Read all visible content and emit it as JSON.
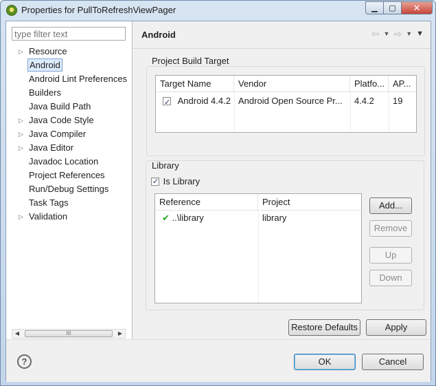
{
  "window": {
    "title": "Properties for PullToRefreshViewPager",
    "minimize_icon": "minimize-icon",
    "maximize_icon": "maximize-icon",
    "close_icon": "close-icon"
  },
  "nav": {
    "filter_placeholder": "type filter text",
    "items": [
      {
        "label": "Resource",
        "expandable": true
      },
      {
        "label": "Android",
        "selected": true
      },
      {
        "label": "Android Lint Preferences"
      },
      {
        "label": "Builders"
      },
      {
        "label": "Java Build Path"
      },
      {
        "label": "Java Code Style",
        "expandable": true
      },
      {
        "label": "Java Compiler",
        "expandable": true
      },
      {
        "label": "Java Editor",
        "expandable": true
      },
      {
        "label": "Javadoc Location"
      },
      {
        "label": "Project References"
      },
      {
        "label": "Run/Debug Settings"
      },
      {
        "label": "Task Tags"
      },
      {
        "label": "Validation",
        "expandable": true
      }
    ],
    "scroll_thumb_text": "III"
  },
  "pane": {
    "title": "Android"
  },
  "build_target": {
    "label": "Project Build Target",
    "columns": [
      "Target Name",
      "Vendor",
      "Platfo...",
      "AP..."
    ],
    "rows": [
      {
        "checked": true,
        "target": "Android 4.4.2",
        "vendor": "Android Open Source Pr...",
        "platform": "4.4.2",
        "api": "19"
      }
    ]
  },
  "library": {
    "label": "Library",
    "is_library_label": "Is Library",
    "is_library_checked": true,
    "columns": [
      "Reference",
      "Project"
    ],
    "rows": [
      {
        "status_icon": "check-icon",
        "reference": "..\\library",
        "project": "library"
      }
    ],
    "buttons": {
      "add": "Add...",
      "remove": "Remove",
      "up": "Up",
      "down": "Down"
    }
  },
  "actions": {
    "restore_defaults": "Restore Defaults",
    "apply": "Apply",
    "ok": "OK",
    "cancel": "Cancel",
    "help_icon": "help-icon"
  },
  "colors": {
    "selection_bg": "#dcebfc",
    "check_green": "#2aa52a",
    "titlebar": "#c3d5ea"
  }
}
